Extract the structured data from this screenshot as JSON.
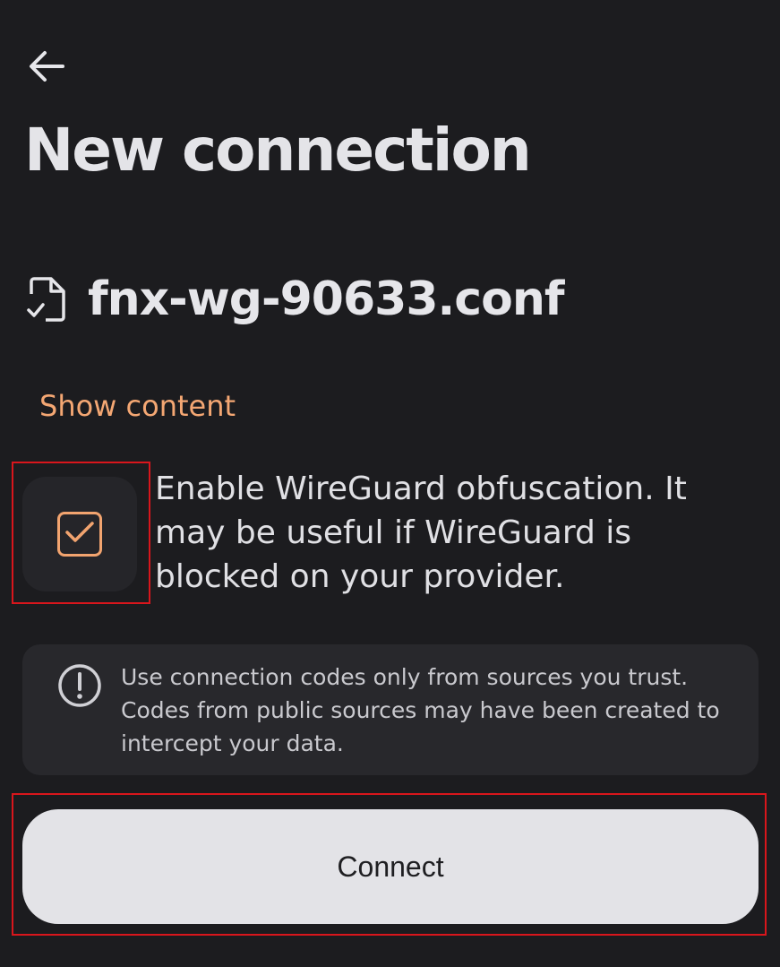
{
  "header": {
    "back_icon": "arrow-left-icon",
    "title": "New connection"
  },
  "file": {
    "icon": "file-check-icon",
    "name": "fnx-wg-90633.conf"
  },
  "show_content_label": "Show content",
  "obfuscation": {
    "checked": true,
    "label": "Enable WireGuard obfuscation. It may be useful if WireGuard is blocked on your provider."
  },
  "warning": {
    "icon": "exclamation-circle-icon",
    "text": "Use connection codes only from sources you trust. Codes from public sources may have been created to intercept your data."
  },
  "connect_label": "Connect",
  "colors": {
    "background": "#1c1c1f",
    "accent": "#f2a46f",
    "highlight": "#d9161c",
    "button_bg": "#e3e3e7"
  }
}
